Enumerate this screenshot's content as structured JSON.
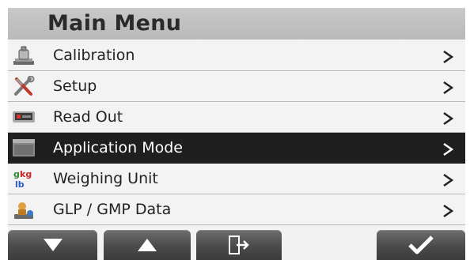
{
  "title": "Main Menu",
  "menu_items": [
    {
      "label": "Calibration",
      "icon": "calibration-weight-icon",
      "selected": false
    },
    {
      "label": "Setup",
      "icon": "tools-icon",
      "selected": false
    },
    {
      "label": "Read Out",
      "icon": "display-icon",
      "selected": false
    },
    {
      "label": "Application Mode",
      "icon": "application-mode-icon",
      "selected": true
    },
    {
      "label": "Weighing Unit",
      "icon": "weighing-unit-icon",
      "selected": false
    },
    {
      "label": "GLP / GMP Data",
      "icon": "glp-gmp-icon",
      "selected": false
    }
  ],
  "unit_icon_text": {
    "g": "g",
    "kg": "kg",
    "lb": "lb"
  },
  "toolbar": [
    {
      "icon": "arrow-down-icon"
    },
    {
      "icon": "arrow-up-icon"
    },
    {
      "icon": "exit-icon"
    },
    {
      "icon": "checkmark-icon"
    }
  ],
  "colors": {
    "selected_row": "#1f1f1f",
    "title_bar": "#c0c0c0",
    "button": "#4a4a4a"
  }
}
